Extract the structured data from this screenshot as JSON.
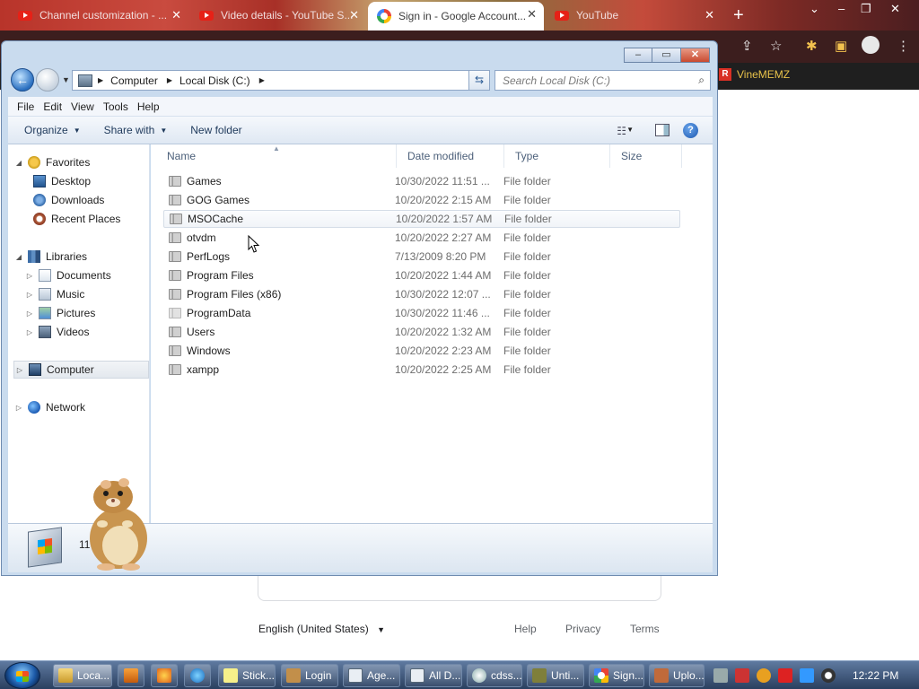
{
  "chrome": {
    "tabs": [
      {
        "label": "Channel customization - ..."
      },
      {
        "label": "Video details - YouTube S..."
      },
      {
        "label": "Sign in - Google Account..."
      },
      {
        "label": "YouTube"
      }
    ],
    "new_tab": "+",
    "bookmark": "VineMEMZ",
    "footer": {
      "language": "English (United States)",
      "help": "Help",
      "privacy": "Privacy",
      "terms": "Terms"
    }
  },
  "explorer": {
    "window_buttons": {
      "minimize": "–",
      "maximize": "▭",
      "close": "✕"
    },
    "breadcrumb": [
      "Computer",
      "Local Disk (C:)"
    ],
    "search_placeholder": "Search Local Disk (C:)",
    "menu": [
      "File",
      "Edit",
      "View",
      "Tools",
      "Help"
    ],
    "toolbar": {
      "organize": "Organize",
      "share_with": "Share with",
      "new_folder": "New folder"
    },
    "nav": {
      "favorites": "Favorites",
      "desktop": "Desktop",
      "downloads": "Downloads",
      "recent_places": "Recent Places",
      "libraries": "Libraries",
      "documents": "Documents",
      "music": "Music",
      "pictures": "Pictures",
      "videos": "Videos",
      "computer": "Computer",
      "network": "Network"
    },
    "columns": {
      "name": "Name",
      "date_modified": "Date modified",
      "type": "Type",
      "size": "Size"
    },
    "files": [
      {
        "name": "Games",
        "date": "10/30/2022 11:51 ...",
        "type": "File folder"
      },
      {
        "name": "GOG Games",
        "date": "10/20/2022 2:15 AM",
        "type": "File folder"
      },
      {
        "name": "MSOCache",
        "date": "10/20/2022 1:57 AM",
        "type": "File folder"
      },
      {
        "name": "otvdm",
        "date": "10/20/2022 2:27 AM",
        "type": "File folder"
      },
      {
        "name": "PerfLogs",
        "date": "7/13/2009 8:20 PM",
        "type": "File folder"
      },
      {
        "name": "Program Files",
        "date": "10/20/2022 1:44 AM",
        "type": "File folder"
      },
      {
        "name": "Program Files (x86)",
        "date": "10/30/2022 12:07 ...",
        "type": "File folder"
      },
      {
        "name": "ProgramData",
        "date": "10/30/2022 11:46 ...",
        "type": "File folder"
      },
      {
        "name": "Users",
        "date": "10/20/2022 1:32 AM",
        "type": "File folder"
      },
      {
        "name": "Windows",
        "date": "10/20/2022 2:23 AM",
        "type": "File folder"
      },
      {
        "name": "xampp",
        "date": "10/20/2022 2:25 AM",
        "type": "File folder"
      }
    ],
    "status_count": "11 it"
  },
  "taskbar": {
    "items": [
      {
        "label": "Loca..."
      },
      {
        "label": "Stick..."
      },
      {
        "label": "Login"
      },
      {
        "label": "Age..."
      },
      {
        "label": "All D..."
      },
      {
        "label": "cdss..."
      },
      {
        "label": "Unti..."
      },
      {
        "label": "Sign..."
      },
      {
        "label": "Uplo..."
      }
    ],
    "clock": "12:22 PM"
  }
}
